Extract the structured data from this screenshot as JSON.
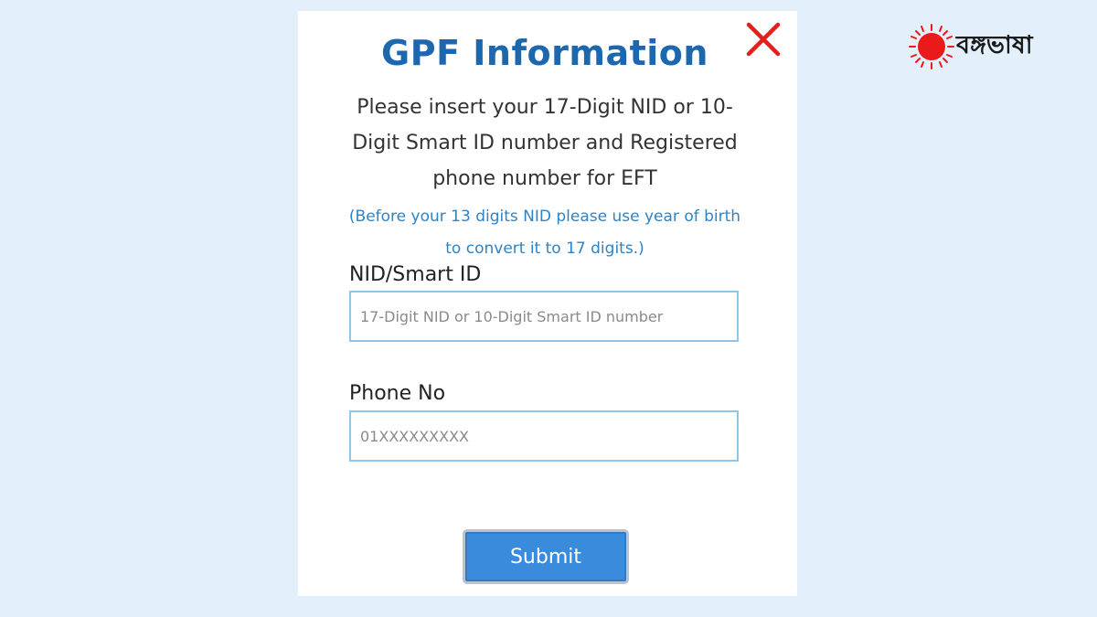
{
  "modal": {
    "title": "GPF Information",
    "instructions": "Please insert your 17-Digit NID or 10-Digit Smart ID number and Registered phone number for EFT",
    "note": "(Before your 13 digits NID please use year of birth to convert it to 17 digits.)",
    "nid": {
      "label": "NID/Smart ID",
      "placeholder": "17-Digit NID or 10-Digit Smart ID number",
      "value": ""
    },
    "phone": {
      "label": "Phone No",
      "placeholder": "01XXXXXXXXX",
      "value": ""
    },
    "submit_label": "Submit",
    "close_icon": "close-x-icon"
  },
  "brand": {
    "name": "বঙ্গভাষা",
    "logo_icon": "red-sun-icon"
  },
  "colors": {
    "background": "#e3f0fc",
    "title": "#1c67ae",
    "note": "#2f83c5",
    "close": "#e0211e",
    "field_border": "#8ec7ea",
    "button": "#3b8bdc",
    "logo_red": "#ea1a1a"
  }
}
